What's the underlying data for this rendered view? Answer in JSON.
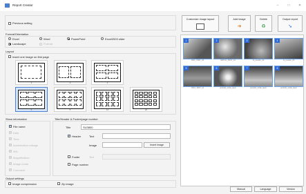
{
  "window": {
    "title": "Report Creator",
    "min": "–",
    "max": "□",
    "close": "✕"
  },
  "previous_setting": "Previous setting",
  "format": {
    "group_label": "Format/Orientation",
    "options": [
      "Excel",
      "Word",
      "PowerPoint",
      "Excel2003 older"
    ],
    "selected": "PowerPoint",
    "orientations": [
      "Landscape",
      "Portrait"
    ],
    "selected_orientation": "Landscape"
  },
  "layout": {
    "group_label": "Layout",
    "insert_one": "Insert one image on first page",
    "numbers": [
      "1",
      "2",
      "4",
      "6",
      "8",
      "12",
      "20"
    ],
    "selected": "6"
  },
  "show_info": {
    "group_label": "Show information",
    "items": [
      "File name",
      "Date",
      "Time",
      "Acceleration voltage",
      "WD",
      "Magnification",
      "Image mode",
      "Comment"
    ],
    "checked": [
      "File name"
    ]
  },
  "title_header": {
    "group_label": "Title/Header & Footer/page number",
    "title_label": "Title",
    "title_value": "SU3800",
    "header_label": "Header",
    "text_label": "Text",
    "image_label": "Image",
    "insert_image": "Insert image",
    "footer_label": "Footer",
    "footer_text_label": "Text",
    "page_number": "Page number"
  },
  "output_settings": {
    "group_label": "Output settings",
    "image_compression": "Image compression",
    "zip_image": "Zip image"
  },
  "toolbar": {
    "customize": "Customize image layout",
    "add_image": "Add image",
    "delete": "Delete",
    "output": "Output report"
  },
  "thumbnails": [
    {
      "n": "1",
      "cap": "0001_TEST_03"
    },
    {
      "n": "2",
      "cap": "WATCH_TEST_01"
    },
    {
      "n": "3",
      "cap": "Al_powder_03"
    },
    {
      "n": "4",
      "cap": "Al_powder_05"
    },
    {
      "n": "5",
      "cap": "0001_TEST_11"
    },
    {
      "n": "6",
      "cap": "periodic_oxide_layer"
    },
    {
      "n": "7",
      "cap": "periodic_oxide_layer"
    },
    {
      "n": "8",
      "cap": "periodic_oxide_layer"
    }
  ],
  "footer_buttons": {
    "manual": "Manual",
    "language": "Language",
    "version": "Version"
  },
  "icons": {
    "customize": "layout-icon",
    "add": "add-image-icon",
    "delete": "recycle-bin-icon",
    "output": "output-report-icon"
  },
  "colors": {
    "accent": "#2d6ad8",
    "selection": "#d8e6fb"
  }
}
